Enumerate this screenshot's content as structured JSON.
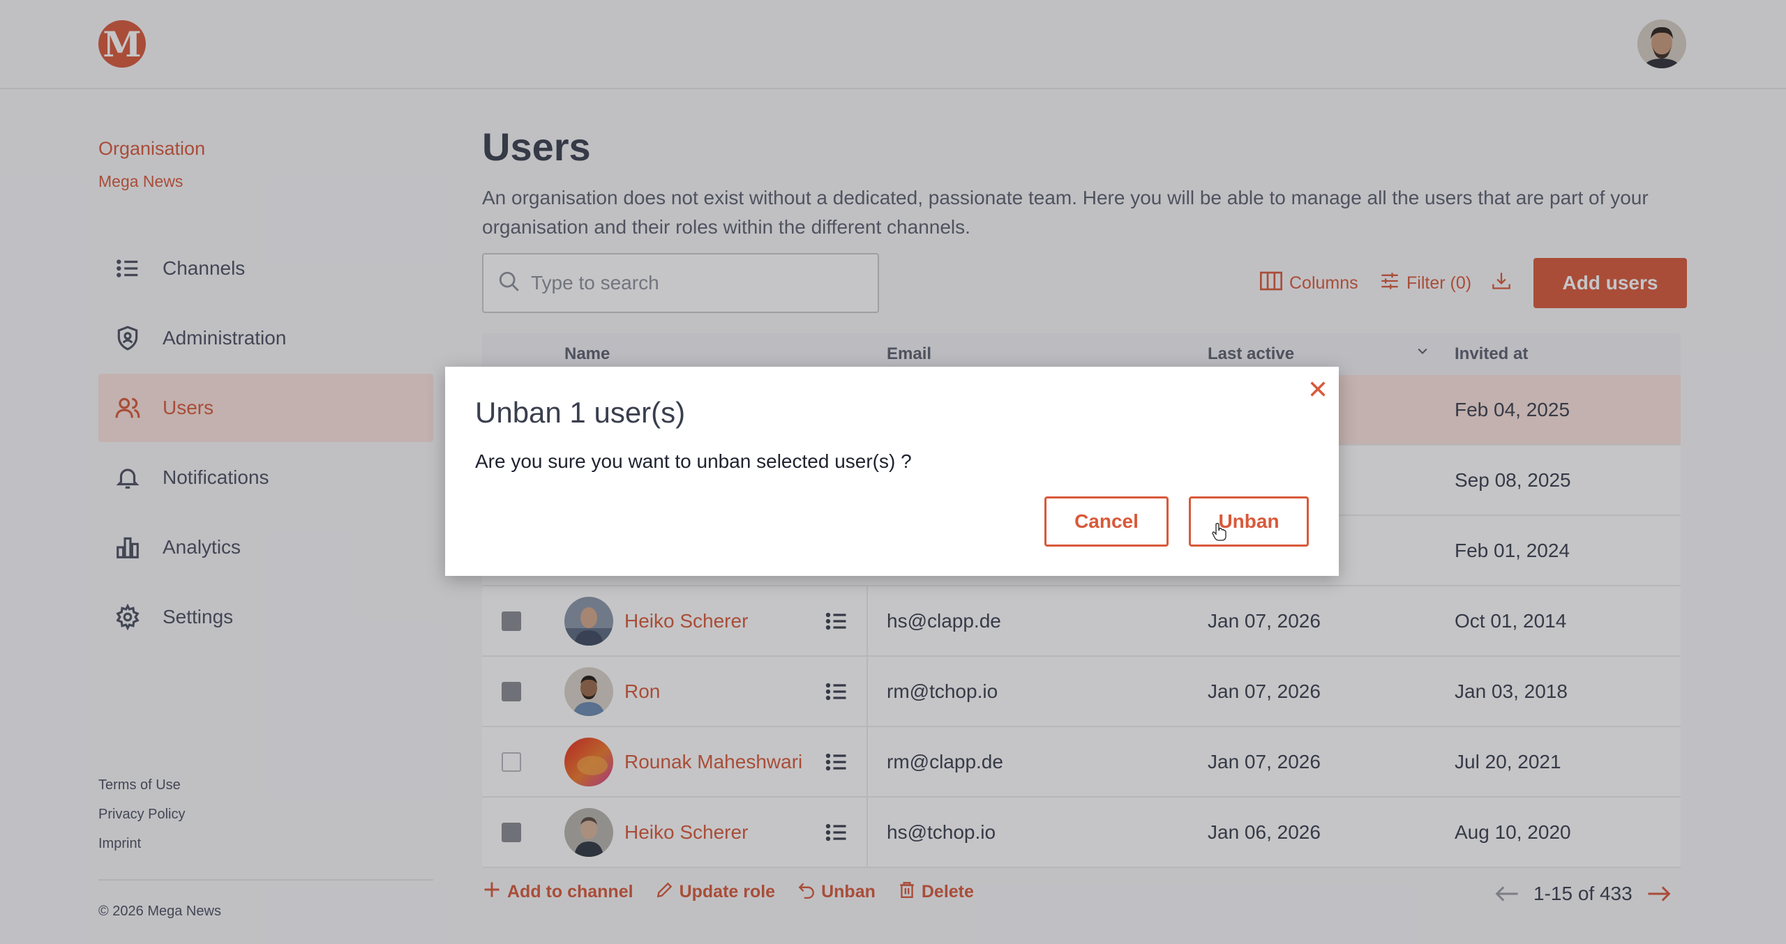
{
  "brand": {
    "logo_letter": "M",
    "accent": "#d9593a"
  },
  "sidebar": {
    "org_label": "Organisation",
    "org_name": "Mega News",
    "items": [
      {
        "label": "Channels",
        "icon": "list-icon"
      },
      {
        "label": "Administration",
        "icon": "shield-icon"
      },
      {
        "label": "Users",
        "icon": "users-icon",
        "active": true
      },
      {
        "label": "Notifications",
        "icon": "bell-icon"
      },
      {
        "label": "Analytics",
        "icon": "bar-chart-icon"
      },
      {
        "label": "Settings",
        "icon": "gear-icon"
      }
    ],
    "footer": {
      "terms": "Terms of Use",
      "privacy": "Privacy Policy",
      "imprint": "Imprint",
      "copyright": "© 2026 Mega News"
    }
  },
  "main": {
    "title": "Users",
    "description": "An organisation does not exist without a dedicated, passionate team. Here you will be able to manage all the users that are part of your organisation and their roles within the different channels.",
    "search": {
      "placeholder": "Type to search",
      "value": ""
    },
    "toolbar": {
      "columns": "Columns",
      "filter": "Filter (0)",
      "add_users": "Add users"
    },
    "table": {
      "headers": {
        "name": "Name",
        "email": "Email",
        "last_active": "Last active",
        "invited_at": "Invited at"
      },
      "rows": [
        {
          "name": "",
          "email": "",
          "last_active": "",
          "invited_at": "Feb 04, 2025",
          "checked": true,
          "selected": true
        },
        {
          "name": "",
          "email": "",
          "last_active": "",
          "invited_at": "Sep 08, 2025",
          "checked": true
        },
        {
          "name": "",
          "email": "",
          "last_active": "",
          "invited_at": "Feb 01, 2024",
          "checked": true
        },
        {
          "name": "Heiko Scherer",
          "email": "hs@clapp.de",
          "last_active": "Jan 07, 2026",
          "invited_at": "Oct 01, 2014",
          "checked": true
        },
        {
          "name": "Ron",
          "email": "rm@tchop.io",
          "last_active": "Jan 07, 2026",
          "invited_at": "Jan 03, 2018",
          "checked": true
        },
        {
          "name": "Rounak Maheshwari",
          "email": "rm@clapp.de",
          "last_active": "Jan 07, 2026",
          "invited_at": "Jul 20, 2021",
          "checked": false
        },
        {
          "name": "Heiko Scherer",
          "email": "hs@tchop.io",
          "last_active": "Jan 06, 2026",
          "invited_at": "Aug 10, 2020",
          "checked": true
        }
      ]
    },
    "bulk_actions": {
      "add_to_channel": "Add to channel",
      "update_role": "Update role",
      "unban": "Unban",
      "delete": "Delete"
    },
    "pagination": {
      "range": "1-15 of 433"
    }
  },
  "modal": {
    "title": "Unban 1 user(s)",
    "message": "Are you sure you want to unban selected user(s) ?",
    "cancel": "Cancel",
    "confirm": "Unban"
  }
}
